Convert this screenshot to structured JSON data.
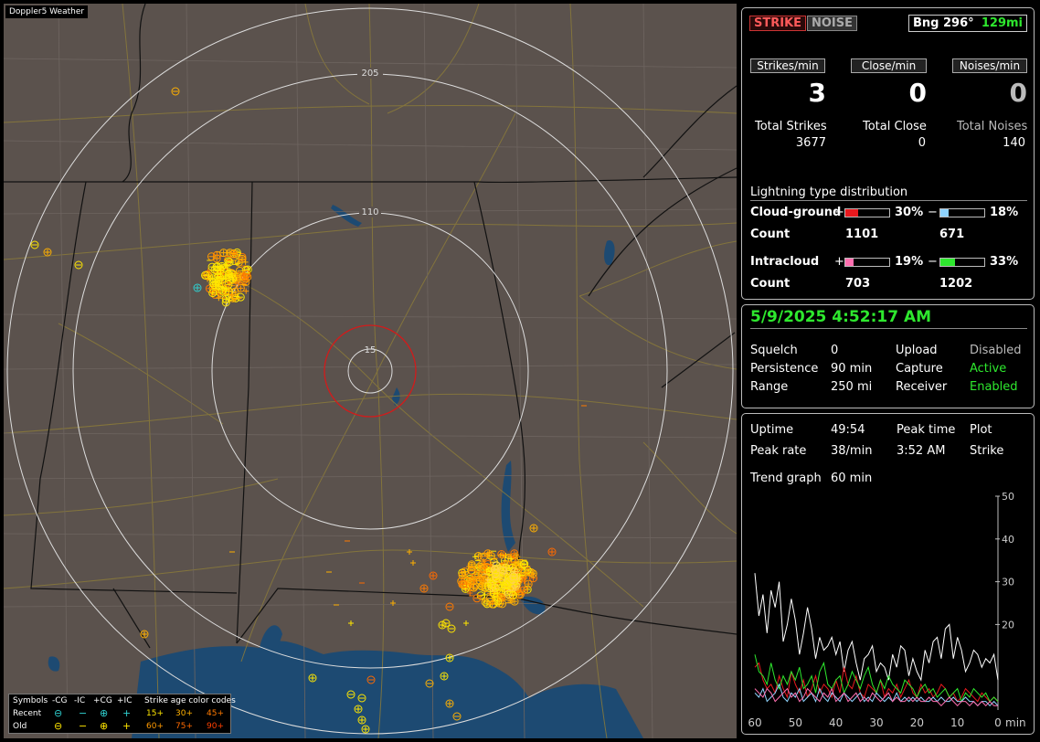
{
  "map": {
    "title": "Doppler5 Weather",
    "rings": [
      "205",
      "110",
      "15"
    ],
    "legend": {
      "symbols_label": "Symbols",
      "headers": [
        "-CG",
        "-IC",
        "+CG",
        "+IC"
      ],
      "age_title": "Strike age color codes",
      "rows": [
        {
          "label": "Recent",
          "ages": [
            "15+",
            "30+",
            "45+"
          ]
        },
        {
          "label": "Old",
          "ages": [
            "60+",
            "75+",
            "90+"
          ]
        }
      ],
      "age_colors": [
        "#ffe600",
        "#ffb000",
        "#ff7a00",
        "#ff9a00",
        "#ff6a00",
        "#ff4000"
      ]
    }
  },
  "header": {
    "strike": "STRIKE",
    "noise": "NOISE",
    "bearing": "Bng 296°",
    "distance": "129mi"
  },
  "rates": [
    {
      "label": "Strikes/min",
      "value": "3"
    },
    {
      "label": "Close/min",
      "value": "0"
    },
    {
      "label": "Noises/min",
      "value": "0"
    }
  ],
  "totals": [
    {
      "label": "Total Strikes",
      "value": "3677"
    },
    {
      "label": "Total Close",
      "value": "0"
    },
    {
      "label": "Total Noises",
      "value": "140"
    }
  ],
  "distribution": {
    "title": "Lightning type distribution",
    "cg": {
      "label": "Cloud-ground",
      "plus_pct": "30%",
      "plus_value": 30,
      "plus_color": "#e8191e",
      "minus_pct": "18%",
      "minus_value": 18,
      "minus_color": "#8fd4ff",
      "count_label": "Count",
      "plus_count": "1101",
      "minus_count": "671"
    },
    "ic": {
      "label": "Intracloud",
      "plus_pct": "19%",
      "plus_value": 19,
      "plus_color": "#ff6fb0",
      "minus_pct": "33%",
      "minus_value": 33,
      "minus_color": "#2ee82e",
      "count_label": "Count",
      "plus_count": "703",
      "minus_count": "1202"
    },
    "plus_sign": "+",
    "minus_sign": "−"
  },
  "status": {
    "datetime": "5/9/2025 4:52:17 AM",
    "rows": [
      {
        "k1": "Squelch",
        "v1": "0",
        "k2": "Upload",
        "v2": "Disabled"
      },
      {
        "k1": "Persistence",
        "v1": "90 min",
        "k2": "Capture",
        "v2": "Active"
      },
      {
        "k1": "Range",
        "v1": "250 mi",
        "k2": "Receiver",
        "v2": "Enabled"
      }
    ]
  },
  "stats": {
    "uptime_label": "Uptime",
    "uptime": "49:54",
    "peak_time_label": "Peak time",
    "plot_label": "Plot",
    "peak_rate_label": "Peak rate",
    "peak_rate": "38/min",
    "peak_time": "3:52 AM",
    "plot": "Strike",
    "trend_label": "Trend graph",
    "trend": "60 min"
  },
  "chart_data": {
    "type": "line",
    "x_ticks": [
      "60",
      "50",
      "40",
      "30",
      "20",
      "10",
      "0"
    ],
    "xlabel": "min",
    "y_ticks": [
      "50",
      "40",
      "30",
      "20"
    ],
    "ylim": [
      0,
      50
    ],
    "xlim": [
      60,
      0
    ],
    "series": [
      {
        "color": "#ffffff",
        "values": [
          32,
          22,
          27,
          18,
          28,
          24,
          30,
          16,
          20,
          26,
          21,
          13,
          18,
          24,
          19,
          12,
          17,
          14,
          15,
          17,
          13,
          16,
          9,
          14,
          16,
          11,
          7,
          12,
          13,
          15,
          9,
          11,
          10,
          7,
          13,
          10,
          15,
          14,
          8,
          12,
          9,
          7,
          14,
          11,
          16,
          17,
          12,
          19,
          20,
          12,
          17,
          14,
          9,
          11,
          14,
          13,
          10,
          12,
          11,
          13,
          7
        ]
      },
      {
        "color": "#e8191e",
        "values": [
          10,
          11,
          7,
          5,
          6,
          4,
          8,
          5,
          3,
          9,
          6,
          4,
          7,
          3,
          5,
          8,
          4,
          6,
          5,
          3,
          7,
          4,
          10,
          6,
          5,
          8,
          4,
          3,
          6,
          5,
          4,
          7,
          3,
          5,
          4,
          6,
          3,
          5,
          7,
          4,
          3,
          6,
          4,
          5,
          3,
          4,
          6,
          5,
          3,
          4,
          2,
          3,
          5,
          4,
          3,
          2,
          4,
          3,
          2,
          3,
          2
        ]
      },
      {
        "color": "#2ee82e",
        "values": [
          13,
          9,
          8,
          6,
          11,
          7,
          5,
          8,
          6,
          9,
          7,
          10,
          5,
          6,
          8,
          4,
          9,
          11,
          6,
          5,
          7,
          8,
          4,
          6,
          9,
          7,
          5,
          8,
          10,
          6,
          4,
          7,
          5,
          8,
          6,
          5,
          4,
          7,
          6,
          5,
          3,
          5,
          6,
          4,
          5,
          3,
          4,
          5,
          3,
          4,
          5,
          2,
          4,
          3,
          5,
          4,
          3,
          4,
          2,
          3,
          2
        ]
      },
      {
        "color": "#8fd4ff",
        "values": [
          4,
          3,
          5,
          2,
          3,
          4,
          6,
          3,
          2,
          4,
          3,
          5,
          2,
          3,
          4,
          2,
          5,
          3,
          2,
          4,
          3,
          2,
          4,
          3,
          2,
          3,
          4,
          2,
          3,
          2,
          4,
          3,
          2,
          3,
          2,
          4,
          2,
          3,
          2,
          3,
          2,
          3,
          2,
          2,
          3,
          2,
          3,
          2,
          2,
          3,
          2,
          2,
          3,
          2,
          2,
          1,
          2,
          2,
          1,
          2,
          1
        ]
      },
      {
        "color": "#ff6fb0",
        "values": [
          5,
          4,
          3,
          5,
          4,
          2,
          3,
          4,
          5,
          3,
          4,
          2,
          3,
          5,
          4,
          3,
          2,
          4,
          3,
          5,
          2,
          3,
          4,
          2,
          3,
          4,
          2,
          3,
          2,
          4,
          3,
          2,
          3,
          4,
          2,
          3,
          2,
          2,
          3,
          2,
          3,
          2,
          2,
          3,
          2,
          2,
          1,
          2,
          3,
          2,
          1,
          2,
          2,
          1,
          2,
          1,
          2,
          1,
          2,
          1,
          1
        ]
      }
    ]
  }
}
